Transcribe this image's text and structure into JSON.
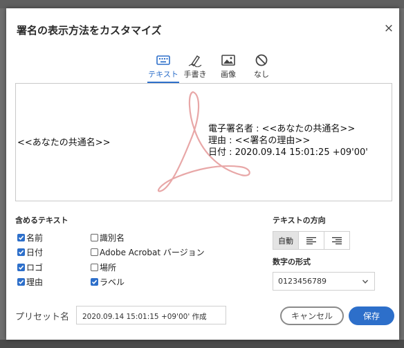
{
  "dialog": {
    "title": "署名の表示方法をカスタマイズ",
    "close_label": "×"
  },
  "tabs": [
    {
      "label": "テキスト",
      "icon": "keyboard-icon",
      "active": true
    },
    {
      "label": "手書き",
      "icon": "pen-icon",
      "active": false
    },
    {
      "label": "画像",
      "icon": "image-icon",
      "active": false
    },
    {
      "label": "なし",
      "icon": "none-icon",
      "active": false
    }
  ],
  "preview": {
    "name_text": "<<あなたの共通名>>",
    "detail_lines": [
      "電子署名者 : <<あなたの共通名>>",
      "理由 : <<署名の理由>>",
      "日付 : 2020.09.14 15:01:25 +09'00'"
    ],
    "watermark_icon": "acrobat-logo-icon"
  },
  "include_text": {
    "title": "含めるテキスト",
    "options": [
      {
        "label": "名前",
        "checked": true
      },
      {
        "label": "日付",
        "checked": true
      },
      {
        "label": "ロゴ",
        "checked": true
      },
      {
        "label": "理由",
        "checked": true
      },
      {
        "label": "識別名",
        "checked": false
      },
      {
        "label": "Adobe Acrobat バージョン",
        "checked": false
      },
      {
        "label": "場所",
        "checked": false
      },
      {
        "label": "ラベル",
        "checked": true
      }
    ]
  },
  "text_direction": {
    "title": "テキストの方向",
    "auto_label": "自動",
    "selected": "自動"
  },
  "number_format": {
    "title": "数字の形式",
    "value": "0123456789"
  },
  "preset": {
    "label": "プリセット名",
    "value": "2020.09.14 15:01:15 +09'00' 作成"
  },
  "buttons": {
    "cancel": "キャンセル",
    "save": "保存"
  },
  "colors": {
    "accent": "#2d6fca",
    "watermark": "#e8a7a7"
  }
}
